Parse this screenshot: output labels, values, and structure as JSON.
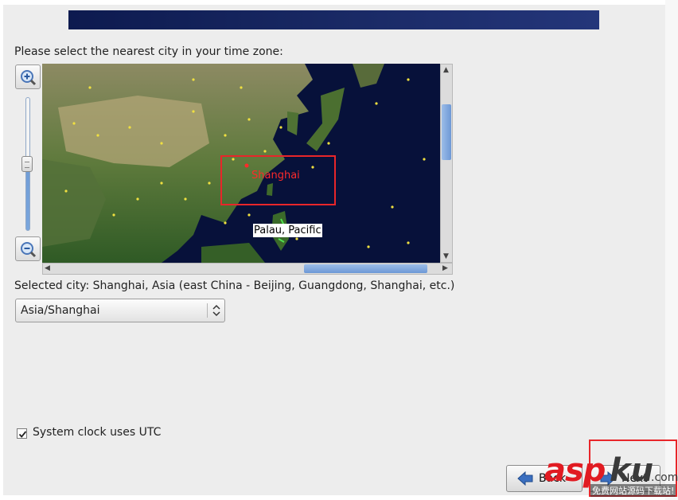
{
  "prompt": "Please select the nearest city in your time zone:",
  "map": {
    "selected_city_label": "Shanghai",
    "hover_city_label": "Palau, Pacific",
    "zoom_in_icon": "zoom-in-magnifier",
    "zoom_out_icon": "zoom-out-magnifier"
  },
  "selected_city_text": "Selected city: Shanghai, Asia (east China - Beijing, Guangdong, Shanghai, etc.)",
  "timezone_select": {
    "value": "Asia/Shanghai"
  },
  "utc": {
    "label": "System clock uses UTC",
    "checked": true
  },
  "buttons": {
    "back_label": "Back",
    "next_label": "Next"
  },
  "watermark": {
    "brand_red": "asp",
    "brand_dark": "ku",
    "suffix": ".com",
    "tagline": "免费网站源码下载站!"
  },
  "colors": {
    "accent": "#e8262a",
    "banner": "#1a2a66",
    "map_ocean": "#07113a"
  }
}
